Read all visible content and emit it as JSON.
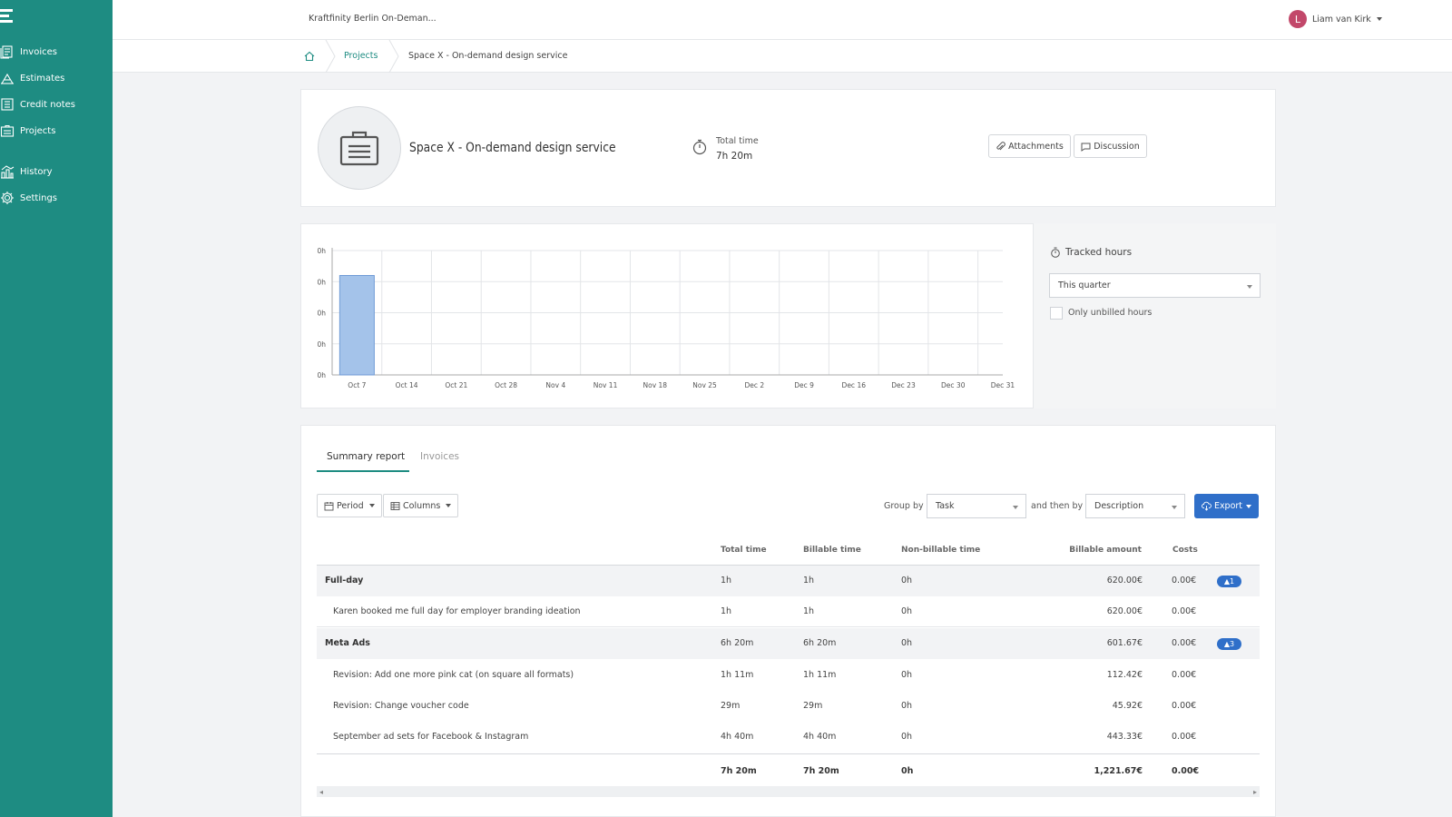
{
  "sidebar": {
    "items": [
      {
        "label": "Invoices",
        "icon": "invoice-icon"
      },
      {
        "label": "Estimates",
        "icon": "estimate-icon"
      },
      {
        "label": "Credit notes",
        "icon": "credit-note-icon"
      },
      {
        "label": "Projects",
        "icon": "projects-icon"
      },
      {
        "label": "History",
        "icon": "history-icon"
      },
      {
        "label": "Settings",
        "icon": "gear-icon"
      }
    ],
    "bg_color": "#1e8c82"
  },
  "header": {
    "company": "Kraftfinity Berlin On-Deman...",
    "user_initial": "L",
    "user_name": "Liam van Kirk"
  },
  "breadcrumb": {
    "projects": "Projects",
    "current": "Space X - On-demand design service"
  },
  "project": {
    "title": "Space X - On-demand design service",
    "total_time_label": "Total time",
    "total_time_value": "7h 20m",
    "attachments_label": "Attachments",
    "discussion_label": "Discussion"
  },
  "chart_data": {
    "type": "bar",
    "categories": [
      "Oct 7",
      "Oct 14",
      "Oct 21",
      "Oct 28",
      "Nov 4",
      "Nov 11",
      "Nov 18",
      "Nov 25",
      "Dec 2",
      "Dec 9",
      "Dec 16",
      "Dec 23",
      "Dec 30",
      "Dec 31"
    ],
    "values": [
      7.33,
      0,
      0,
      0,
      0,
      0,
      0,
      0,
      0,
      0,
      0,
      0,
      0,
      0
    ],
    "y_tick_labels": [
      "0h",
      "0h",
      "0h",
      "0h",
      "0h"
    ],
    "ylim": [
      0,
      9.17
    ],
    "grid": true,
    "bar_color": "#a4c3ea"
  },
  "tracked": {
    "title": "Tracked hours",
    "period": "This quarter",
    "unbilled_label": "Only unbilled hours"
  },
  "report": {
    "tabs": [
      "Summary report",
      "Invoices"
    ],
    "period_label": "Period",
    "columns_label": "Columns",
    "group_by_label": "Group by",
    "group_by_value": "Task",
    "then_by_label": "and then by",
    "then_by_value": "Description",
    "export_label": "Export",
    "headers": {
      "total": "Total time",
      "billable": "Billable time",
      "nonbillable": "Non-billable time",
      "amount": "Billable amount",
      "costs": "Costs"
    },
    "rows": [
      {
        "name": "Full-day",
        "total": "1h",
        "billable": "1h",
        "nonbillable": "0h",
        "amount": "620.00€",
        "costs": "0.00€",
        "badge": "▲1"
      },
      {
        "name": "Karen booked me full day for employer branding ideation",
        "total": "1h",
        "billable": "1h",
        "nonbillable": "0h",
        "amount": "620.00€",
        "costs": "0.00€"
      },
      {
        "name": "Meta Ads",
        "total": "6h 20m",
        "billable": "6h 20m",
        "nonbillable": "0h",
        "amount": "601.67€",
        "costs": "0.00€",
        "badge": "▲3"
      },
      {
        "name": "Revision: Add one more pink cat (on square all formats)",
        "total": "1h 11m",
        "billable": "1h 11m",
        "nonbillable": "0h",
        "amount": "112.42€",
        "costs": "0.00€"
      },
      {
        "name": "Revision: Change voucher code",
        "total": "29m",
        "billable": "29m",
        "nonbillable": "0h",
        "amount": "45.92€",
        "costs": "0.00€"
      },
      {
        "name": "September ad sets for Facebook & Instagram",
        "total": "4h 40m",
        "billable": "4h 40m",
        "nonbillable": "0h",
        "amount": "443.33€",
        "costs": "0.00€"
      }
    ],
    "totals": {
      "total": "7h 20m",
      "billable": "7h 20m",
      "nonbillable": "0h",
      "amount": "1,221.67€",
      "costs": "0.00€"
    }
  }
}
